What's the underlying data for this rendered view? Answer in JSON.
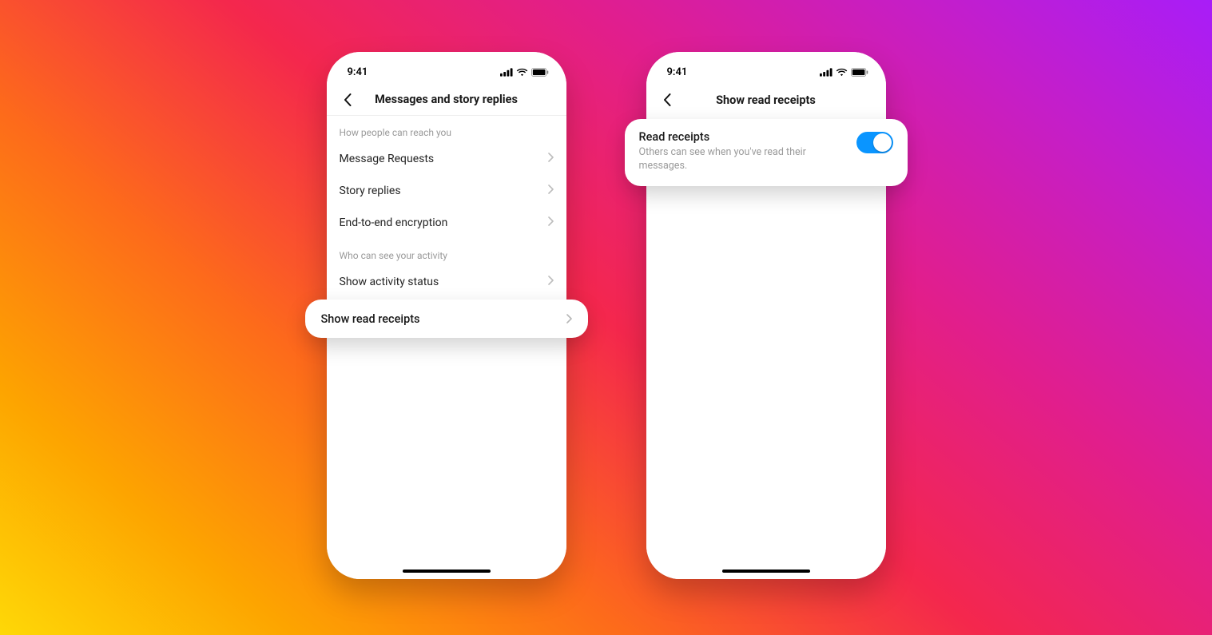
{
  "status": {
    "time": "9:41"
  },
  "phone1": {
    "nav_title": "Messages and story replies",
    "section1_caption": "How people can reach you",
    "rows1": [
      {
        "label": "Message Requests"
      },
      {
        "label": "Story replies"
      },
      {
        "label": "End-to-end encryption"
      }
    ],
    "section2_caption": "Who can see your activity",
    "rows2": [
      {
        "label": "Show activity status"
      }
    ],
    "highlight_row_label": "Show read receipts"
  },
  "phone2": {
    "nav_title": "Show read receipts",
    "card": {
      "title": "Read receipts",
      "subtitle": "Others can see when you've read their messages.",
      "toggle_on": true
    }
  },
  "colors": {
    "toggle_on": "#0a95ff"
  }
}
